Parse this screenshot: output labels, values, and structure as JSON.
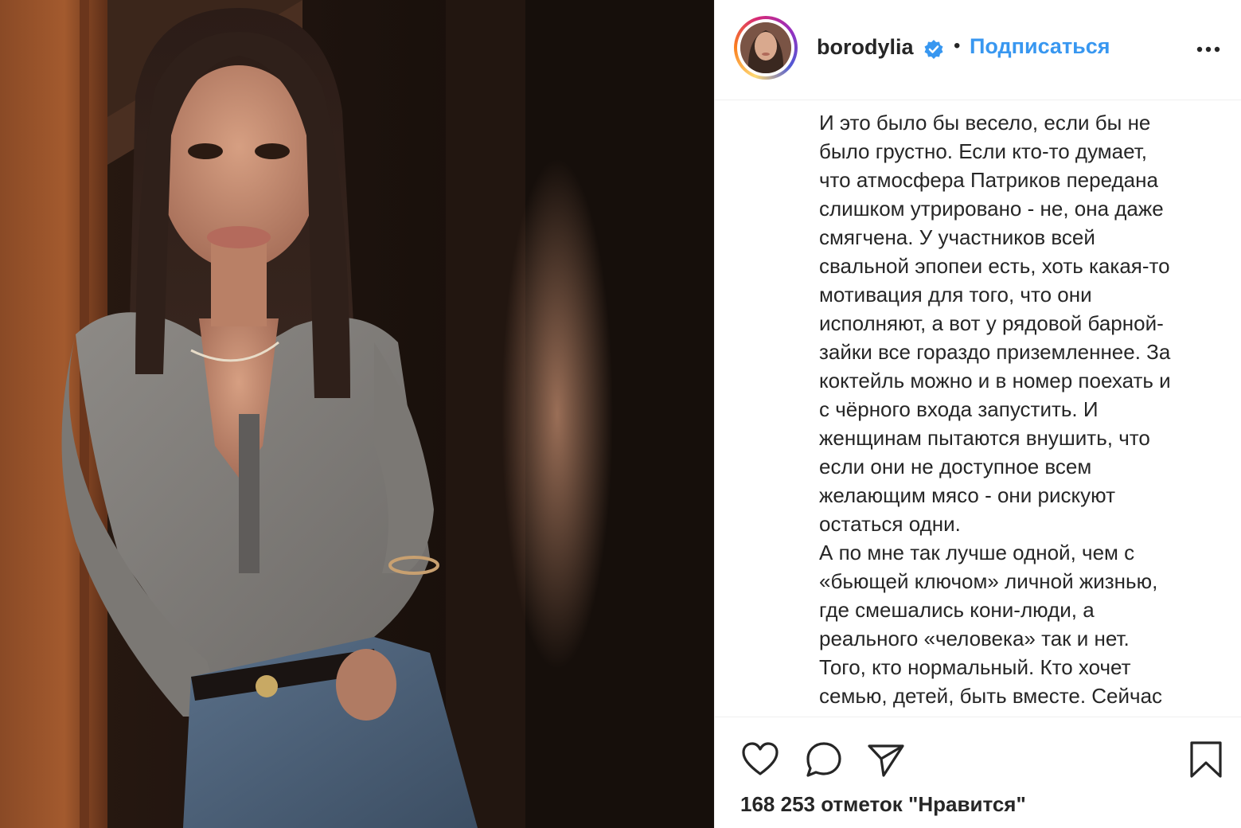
{
  "post": {
    "username": "borodylia",
    "separator": "•",
    "follow_label": "Подписаться",
    "caption": "И это было бы весело, если бы не\nбыло грустно. Если кто-то думает,\nчто атмосфера Патриков передана\nслишком утрировано - не, она даже\nсмягчена. У участников всей\nсвальной эпопеи есть, хоть какая-то\nмотивация для того, что они\nисполняют, а вот у рядовой барной-\nзайки все гораздо приземленнее. За\nкоктейль можно и в номер поехать и\nс чёрного входа запустить. И\nженщинам пытаются внушить, что\nесли они не доступное всем\nжелающим мясо - они рискуют\nостаться одни.\nА по мне так лучше одной, чем с\n«бьющей ключом» личной жизнью,\nгде смешались кони-люди, а\nреального «человека» так и нет.\nТого, кто нормальный. Кто хочет\nсемью, детей, быть вместе. Сейчас",
    "likes_text": "168 253 отметок \"Нравится\""
  },
  "icons": {
    "verified": "verified-badge-icon",
    "more": "more-options-icon",
    "like": "heart-icon",
    "comment": "comment-bubble-icon",
    "share": "paper-plane-icon",
    "save": "bookmark-icon"
  },
  "colors": {
    "accent": "#3897f0",
    "text": "#262626",
    "divider": "#efefef"
  }
}
